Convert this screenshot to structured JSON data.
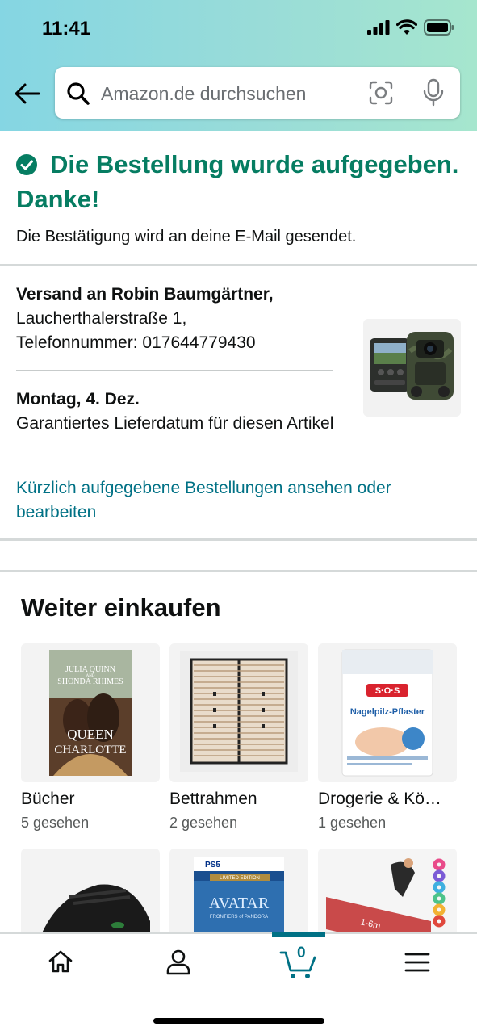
{
  "status_bar": {
    "time": "11:41"
  },
  "search": {
    "placeholder": "Amazon.de durchsuchen"
  },
  "confirmation": {
    "title": "Die Bestellung wurde aufgegeben. Danke!",
    "subtitle": "Die Bestätigung wird an deine E-Mail gesendet."
  },
  "shipping": {
    "recipient": "Versand an Robin Baumgärtner,",
    "street": "Laucherthalerstraße 1,",
    "phone": "Telefonnummer: 017644779430",
    "delivery_date": "Montag, 4. Dez.",
    "delivery_note": "Garantiertes Lieferdatum für diesen Artikel",
    "orders_link": "Kürzlich aufgegebene Bestellungen ansehen oder bearbeiten"
  },
  "continue_shopping": {
    "title": "Weiter einkaufen",
    "tiles": [
      {
        "label": "Bücher",
        "sub": "5 gesehen",
        "book_author1": "JULIA QUINN",
        "book_and": "AND",
        "book_author2": "SHONDA RHIMES",
        "book_title1": "QUEEN",
        "book_title2": "CHARLOTTE"
      },
      {
        "label": "Bettrahmen",
        "sub": "2 gesehen"
      },
      {
        "label": "Drogerie & Kö…",
        "sub": "1 gesehen",
        "brand": "S·O·S",
        "product": "Nagelpilz-Pflaster"
      },
      {
        "label": "",
        "sub": ""
      },
      {
        "label": "",
        "sub": "",
        "platform": "PS5",
        "edition": "LIMITED EDITION",
        "game": "AVATAR",
        "game_sub": "FRONTIERS of PANDORA"
      },
      {
        "label": "",
        "sub": "",
        "mat_text": "1-6m"
      }
    ]
  },
  "cart": {
    "count": "0"
  },
  "colors": {
    "success": "#067d62",
    "link": "#007185",
    "header_from": "#85d6e3",
    "header_to": "#a6e6ce"
  }
}
